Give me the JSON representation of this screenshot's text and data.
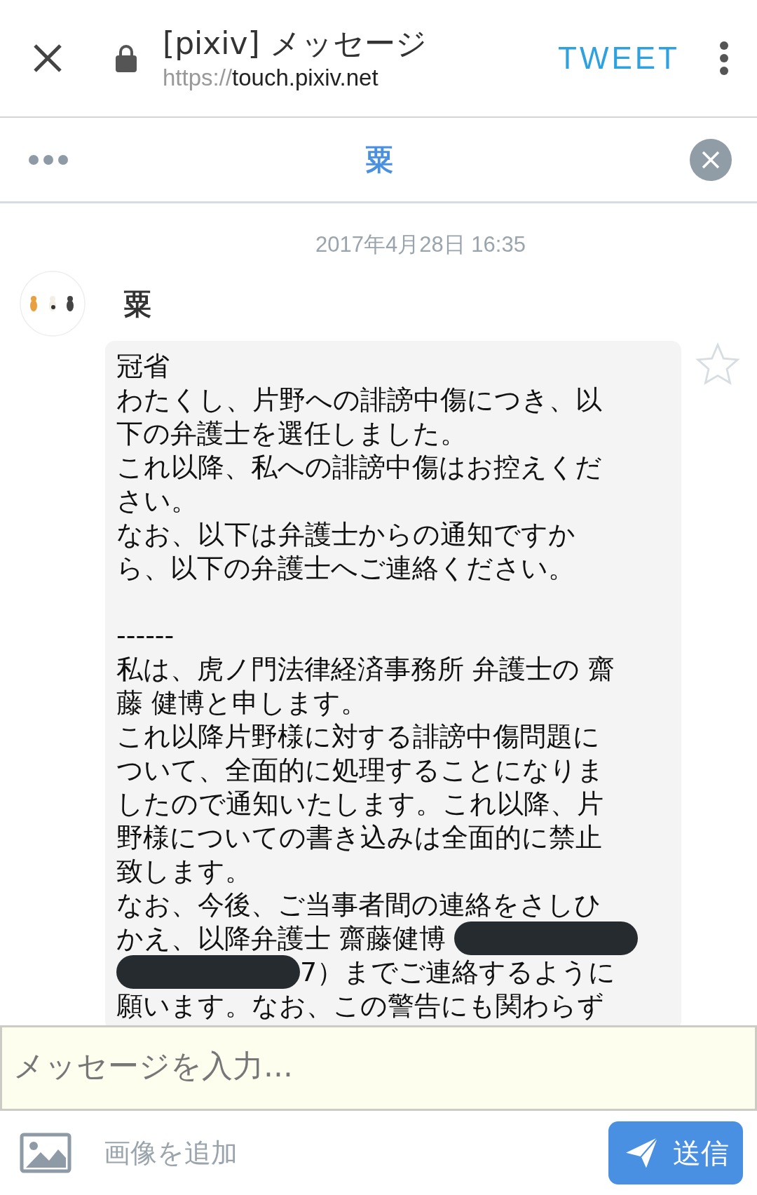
{
  "browser_bar": {
    "title": "[pixiv] メッセージ",
    "url_scheme": "https://",
    "url_host": "touch.pixiv.net",
    "action": "TWEET"
  },
  "thread_header": {
    "title": "粟"
  },
  "chat": {
    "timestamp": "2017年4月28日 16:35",
    "sender": "粟",
    "starred": false,
    "blocks": [
      [
        [
          {
            "text": "冠省"
          }
        ],
        [
          {
            "text": "わたくし、片野への誹謗中傷につき、以"
          }
        ],
        [
          {
            "text": "下の弁護士を選任しました。"
          }
        ],
        [
          {
            "text": "これ以降、私への誹謗中傷はお控えくだ"
          }
        ],
        [
          {
            "text": "さい。"
          }
        ],
        [
          {
            "text": "なお、以下は弁護士からの通知ですか"
          }
        ],
        [
          {
            "text": "ら、以下の弁護士へご連絡ください。"
          }
        ]
      ],
      [
        [
          {
            "text": "------"
          }
        ],
        [
          {
            "text": "私は、虎ノ門法律経済事務所 弁護士の 齋"
          }
        ],
        [
          {
            "text": "藤 健博と申します。"
          }
        ],
        [
          {
            "text": "これ以降片野様に対する誹謗中傷問題に"
          }
        ],
        [
          {
            "text": "ついて、全面的に処理することになりま"
          }
        ],
        [
          {
            "text": "したので通知いたします。これ以降、片"
          }
        ],
        [
          {
            "text": "野様についての書き込みは全面的に禁止"
          }
        ],
        [
          {
            "text": "致します。"
          }
        ],
        [
          {
            "text": "なお、今後、ご当事者間の連絡をさしひ"
          }
        ],
        [
          {
            "text": "かえ、以降弁護士 齋藤健博 "
          },
          {
            "kind": "redaction"
          }
        ],
        [
          {
            "kind": "redaction"
          },
          {
            "text": "7）までご連絡するように"
          }
        ],
        [
          {
            "text": "願います。なお、この警告にも関わらず"
          }
        ]
      ]
    ]
  },
  "composer": {
    "placeholder": "メッセージを入力...",
    "add_image": "画像を追加",
    "send": "送信"
  }
}
